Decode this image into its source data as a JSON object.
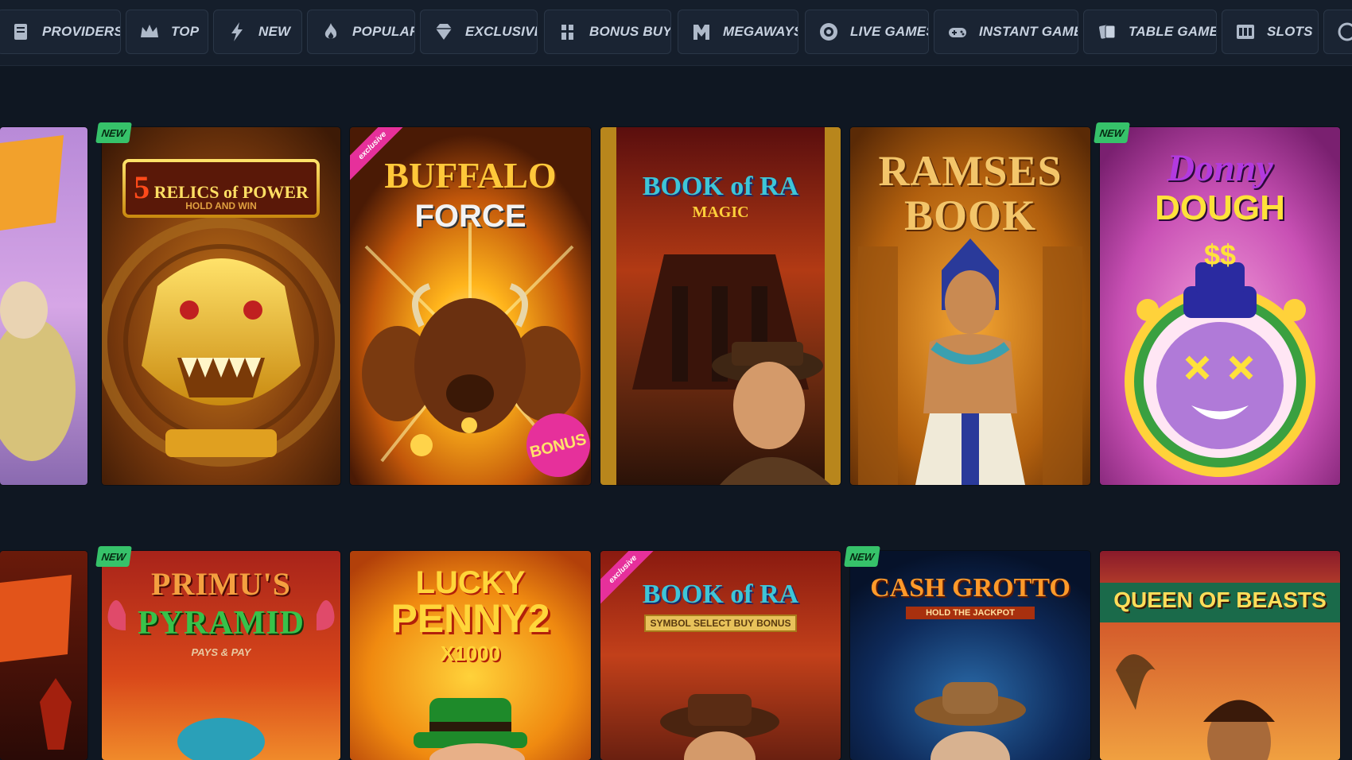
{
  "nav": {
    "categories": [
      {
        "label": "Providers",
        "icon": "providers-icon"
      },
      {
        "label": "Top",
        "icon": "crown-icon"
      },
      {
        "label": "New",
        "icon": "lightning-icon"
      },
      {
        "label": "Popular",
        "icon": "flame-icon"
      },
      {
        "label": "Exclusive",
        "icon": "diamond-icon"
      },
      {
        "label": "Bonus Buys",
        "icon": "bonus-buys-icon"
      },
      {
        "label": "Megaways",
        "icon": "megaways-icon"
      },
      {
        "label": "Live Games",
        "icon": "chip-icon"
      },
      {
        "label": "Instant Games",
        "icon": "gamepad-icon"
      },
      {
        "label": "Table Games",
        "icon": "table-games-icon"
      },
      {
        "label": "Slots",
        "icon": "slots-icon"
      }
    ]
  },
  "badges": {
    "new": "NEW",
    "exclusive": "exclusive"
  },
  "games_row1": [
    {
      "title": "",
      "badge": ""
    },
    {
      "title": "RELICS of POWER",
      "prefix": "5",
      "subtitle": "HOLD AND WIN",
      "badge": "NEW"
    },
    {
      "title": "BUFFALO",
      "title2": "FORCE",
      "badge": "exclusive",
      "corner": "BONUS"
    },
    {
      "title": "BOOK of RA",
      "subtitle": "MAGIC",
      "badge": ""
    },
    {
      "title": "RAMSES",
      "title2": "BOOK",
      "badge": ""
    },
    {
      "title": "Donny",
      "title2": "DOUGH",
      "badge": "NEW"
    }
  ],
  "games_row2": [
    {
      "title": "",
      "badge": ""
    },
    {
      "title": "PRIMU'S",
      "title2": "PYRAMID",
      "subtitle": "PAYS & PAY",
      "badge": "NEW"
    },
    {
      "title": "LUCKY",
      "title2": "PENNY",
      "num": "2",
      "subtitle": "X1000",
      "badge": ""
    },
    {
      "title": "BOOK of RA",
      "subtitle": "SYMBOL SELECT BUY BONUS",
      "badge": "exclusive"
    },
    {
      "title": "CASH GROTTO",
      "subtitle": "HOLD THE JACKPOT",
      "badge": "NEW"
    },
    {
      "title": "QUEEN OF BEASTS",
      "badge": ""
    }
  ],
  "colors": {
    "background": "#0f1722",
    "navbar": "#151e2b",
    "new_badge": "#36c26a",
    "exclusive_ribbon": "#e6309b"
  }
}
